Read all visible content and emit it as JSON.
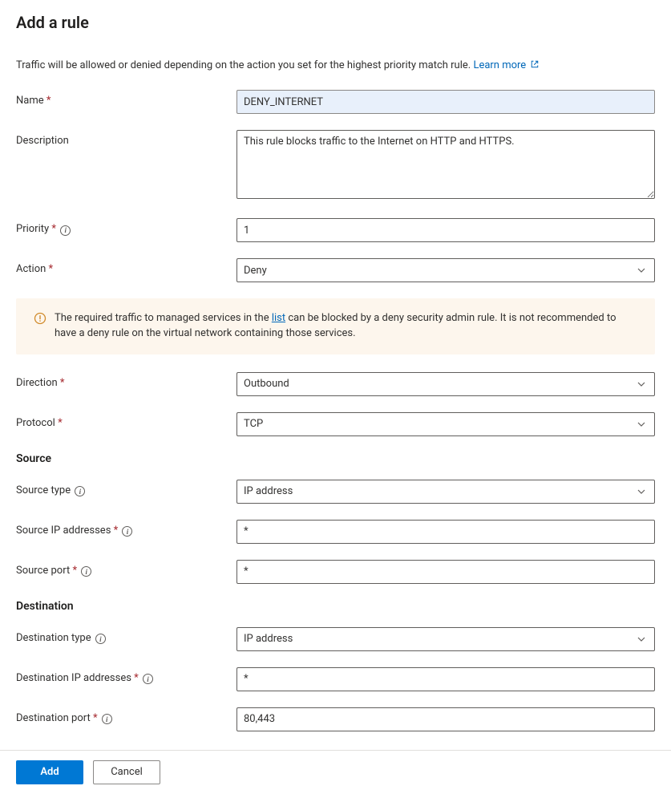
{
  "title": "Add a rule",
  "intro_text": "Traffic will be allowed or denied depending on the action you set for the highest priority match rule.",
  "learn_more": "Learn more",
  "fields": {
    "name": {
      "label": "Name",
      "required": true,
      "value": "DENY_INTERNET"
    },
    "description": {
      "label": "Description",
      "required": false,
      "value": "This rule blocks traffic to the Internet on HTTP and HTTPS."
    },
    "priority": {
      "label": "Priority",
      "required": true,
      "info": true,
      "value": "1"
    },
    "action": {
      "label": "Action",
      "required": true,
      "value": "Deny"
    },
    "direction": {
      "label": "Direction",
      "required": true,
      "value": "Outbound"
    },
    "protocol": {
      "label": "Protocol",
      "required": true,
      "value": "TCP"
    }
  },
  "banner": {
    "pre": "The required traffic to managed services in the ",
    "link": "list",
    "post": " can be blocked by a deny security admin rule. It is not recommended to have a deny rule on the virtual network containing those services."
  },
  "source": {
    "heading": "Source",
    "type": {
      "label": "Source type",
      "info": true,
      "value": "IP address"
    },
    "ips": {
      "label": "Source IP addresses",
      "required": true,
      "info": true,
      "value": "*"
    },
    "port": {
      "label": "Source port",
      "required": true,
      "info": true,
      "value": "*"
    }
  },
  "destination": {
    "heading": "Destination",
    "type": {
      "label": "Destination type",
      "info": true,
      "value": "IP address"
    },
    "ips": {
      "label": "Destination IP addresses",
      "required": true,
      "info": true,
      "value": "*"
    },
    "port": {
      "label": "Destination port",
      "required": true,
      "info": true,
      "value": "80,443"
    }
  },
  "footer": {
    "add": "Add",
    "cancel": "Cancel"
  }
}
